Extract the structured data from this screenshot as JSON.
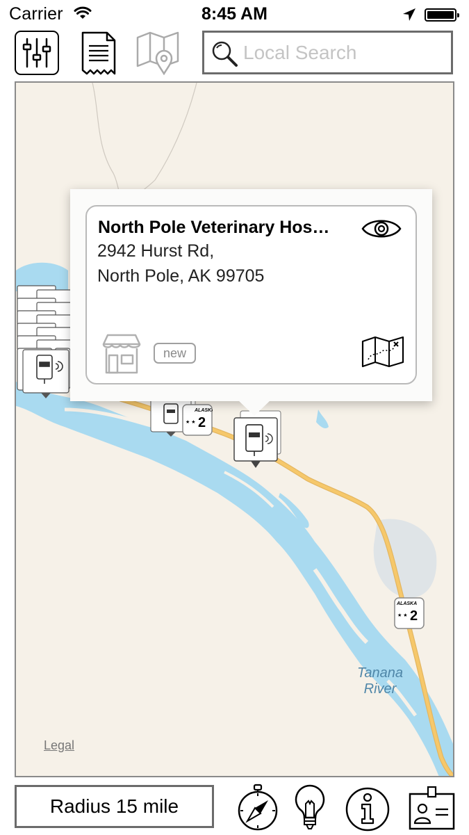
{
  "status_bar": {
    "carrier": "Carrier",
    "time": "8:45 AM",
    "icons": [
      "wifi-icon",
      "location-arrow-icon",
      "battery-icon"
    ]
  },
  "toolbar": {
    "buttons": [
      "filters-sliders-icon",
      "receipt-list-icon",
      "map-pin-icon"
    ],
    "search": {
      "placeholder": "Local Search",
      "value": ""
    }
  },
  "map": {
    "legal_label": "Legal",
    "river_label_line1": "Tanana",
    "river_label_line2": "River",
    "highway_shield_text": "ALASKA",
    "highway_shield_number": "2",
    "colors": {
      "land": "#f6f1e8",
      "water": "#a9daf0",
      "road": "#f6c86b"
    }
  },
  "callout": {
    "name": "North Pole Veterinary Hos…",
    "address_line1": "2942 Hurst Rd,",
    "address_line2": "North Pole, AK 99705",
    "badge": "new",
    "icons": [
      "eye-icon",
      "storefront-icon",
      "route-map-icon"
    ]
  },
  "bottom_bar": {
    "radius_label": "Radius 15 mile",
    "icons": [
      "compass-icon",
      "lightbulb-icon",
      "info-icon",
      "contact-card-icon"
    ]
  }
}
